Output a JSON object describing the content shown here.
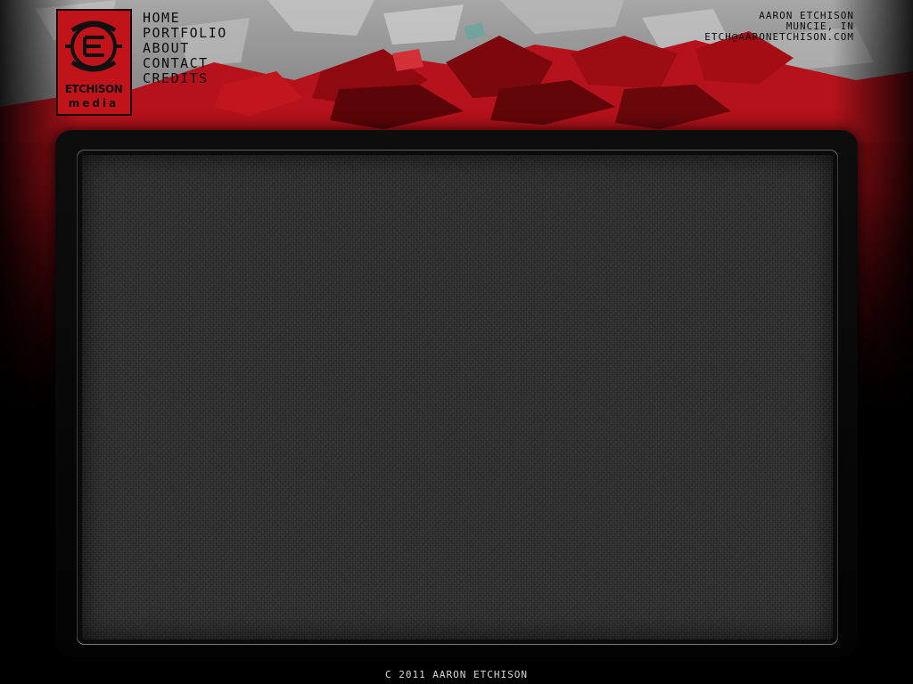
{
  "logo": {
    "title_top": "ETCHISON",
    "title_bottom": "media",
    "accent_color": "#c0141a"
  },
  "nav": {
    "items": [
      {
        "label": "HOME"
      },
      {
        "label": "PORTFOLIO"
      },
      {
        "label": "ABOUT"
      },
      {
        "label": "CONTACT"
      },
      {
        "label": "CREDITS"
      }
    ]
  },
  "contact": {
    "name": "AARON ETCHISON",
    "location": "MUNCIE, IN",
    "email": "ETCH@AARONETCHISON.COM"
  },
  "footer": {
    "copyright": "C 2011 AARON ETCHISON"
  },
  "colors": {
    "background": "#000000",
    "header_red": "#b4141c",
    "header_grey": "#9a9a9a",
    "content_panel": "#2c2c2c",
    "footer_text": "#d8d8d8"
  }
}
